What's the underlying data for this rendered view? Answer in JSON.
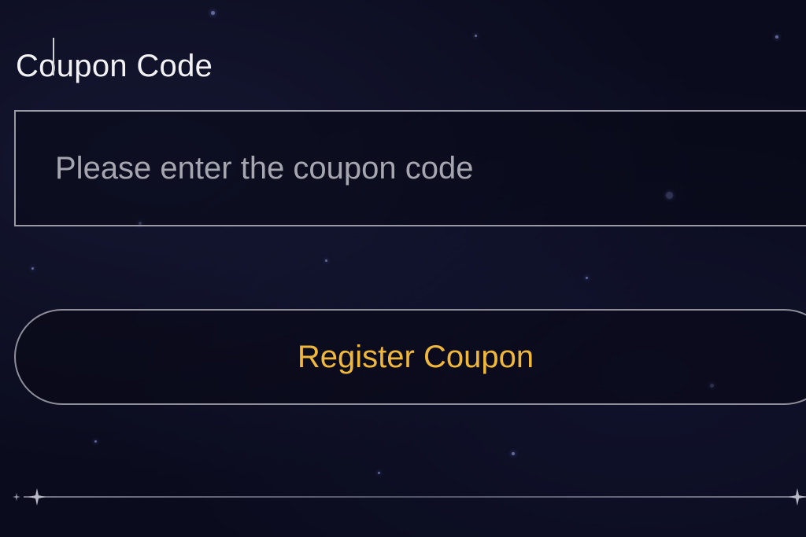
{
  "coupon": {
    "label": "Coupon Code",
    "input_value": "",
    "placeholder": "Please enter the coupon code"
  },
  "register_button": {
    "label": "Register Coupon"
  },
  "colors": {
    "background": "#0a0b1c",
    "label_text": "#f2f2f4",
    "placeholder_text": "#a6a6b0",
    "button_text": "#efb73c",
    "border": "#9a9aa6"
  },
  "icons": {
    "divider_left": "sparkle-icon",
    "divider_right": "sparkle-icon"
  }
}
